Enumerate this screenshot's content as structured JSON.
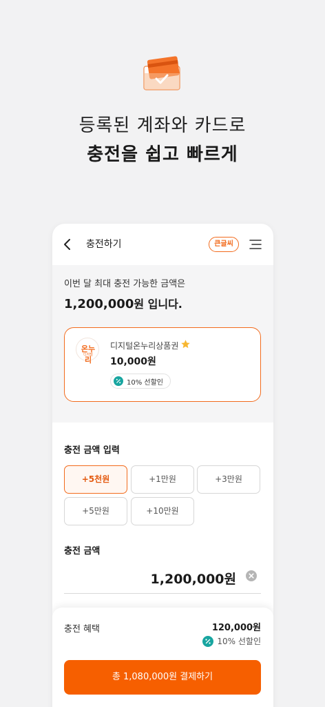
{
  "headline": {
    "line1": "등록된 계좌와 카드로",
    "line2": "충전을 쉽고 빠르게"
  },
  "appbar": {
    "title": "충전하기",
    "font_badge": "큰글씨"
  },
  "summary": {
    "limit_text": "이번 달 최대 충전 가능한 금액은",
    "limit_amount": "1,200,000",
    "limit_suffix": "원 입니다."
  },
  "voucher": {
    "logo_text": "온누리",
    "logo_sub": "디지털",
    "name": "디지털온누리상품권",
    "price": "10,000원",
    "discount": "10% 선할인"
  },
  "charge_input": {
    "section_title": "충전 금액 입력",
    "buttons": [
      {
        "label": "+5천원",
        "active": true
      },
      {
        "label": "+1만원",
        "active": false
      },
      {
        "label": "+3만원",
        "active": false
      },
      {
        "label": "+5만원",
        "active": false
      },
      {
        "label": "+10만원",
        "active": false
      }
    ]
  },
  "charge_amount": {
    "section_title": "충전 금액",
    "value": "1,200,000원"
  },
  "benefit": {
    "label": "충전 혜택",
    "amount": "120,000원",
    "rate": "10% 선할인"
  },
  "pay_button": "총 1,080,000원 결제하기",
  "colors": {
    "accent": "#f26a1b",
    "pay_button": "#f65f00",
    "discount_icon": "#18a5a0"
  }
}
